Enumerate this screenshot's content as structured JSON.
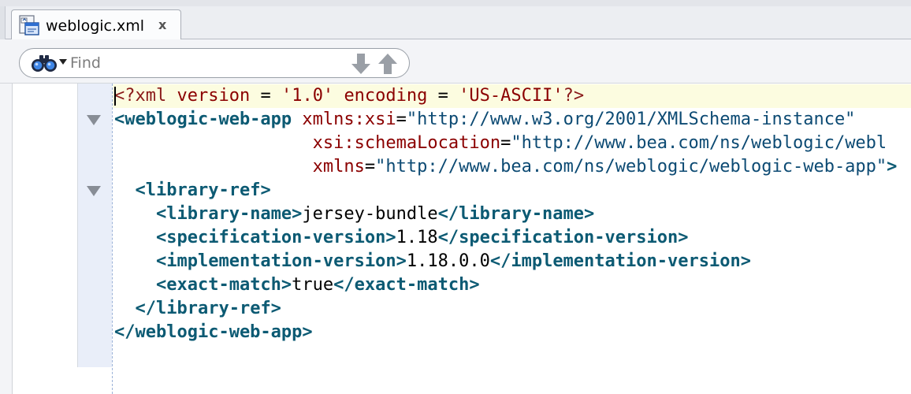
{
  "tab": {
    "label": "weblogic.xml",
    "close_label": "x",
    "icon": "xml-file-icon"
  },
  "find": {
    "placeholder": "Find",
    "value": "",
    "icons": [
      "binoculars-icon",
      "dropdown-caret-icon",
      "arrow-down-icon",
      "arrow-up-icon"
    ]
  },
  "colors": {
    "tag": "#0c5a73",
    "attr": "#8b0000",
    "value": "#0c4a73",
    "current_line": "#fcfce0",
    "gutter": "#e9eef9"
  },
  "editor": {
    "lines": [
      {
        "tokens": [
          {
            "t": "pi",
            "v": "<?xml "
          },
          {
            "t": "attr",
            "v": "version"
          },
          {
            "t": "eq",
            "v": " = "
          },
          {
            "t": "attr",
            "v": "'1.0'"
          },
          {
            "t": "text",
            "v": " "
          },
          {
            "t": "attr",
            "v": "encoding"
          },
          {
            "t": "eq",
            "v": " = "
          },
          {
            "t": "attr",
            "v": "'US-ASCII'"
          },
          {
            "t": "pi",
            "v": "?>"
          }
        ]
      },
      {
        "tokens": [
          {
            "t": "tag",
            "v": "<weblogic-web-app"
          },
          {
            "t": "text",
            "v": " "
          },
          {
            "t": "attr",
            "v": "xmlns:xsi"
          },
          {
            "t": "eq",
            "v": "="
          },
          {
            "t": "val",
            "v": "\"http://www.w3.org/2001/XMLSchema-instance\""
          }
        ]
      },
      {
        "tokens": [
          {
            "t": "text",
            "v": "                   "
          },
          {
            "t": "attr",
            "v": "xsi:schemaLocation"
          },
          {
            "t": "eq",
            "v": "="
          },
          {
            "t": "val",
            "v": "\"http://www.bea.com/ns/weblogic/webl"
          }
        ]
      },
      {
        "tokens": [
          {
            "t": "text",
            "v": "                   "
          },
          {
            "t": "attr",
            "v": "xmlns"
          },
          {
            "t": "eq",
            "v": "="
          },
          {
            "t": "val",
            "v": "\"http://www.bea.com/ns/weblogic/weblogic-web-app\""
          },
          {
            "t": "tag",
            "v": ">"
          }
        ]
      },
      {
        "tokens": [
          {
            "t": "text",
            "v": "  "
          },
          {
            "t": "tag",
            "v": "<library-ref>"
          }
        ]
      },
      {
        "tokens": [
          {
            "t": "text",
            "v": "    "
          },
          {
            "t": "tag",
            "v": "<library-name>"
          },
          {
            "t": "text",
            "v": "jersey-bundle"
          },
          {
            "t": "tag",
            "v": "</library-name>"
          }
        ]
      },
      {
        "tokens": [
          {
            "t": "text",
            "v": "    "
          },
          {
            "t": "tag",
            "v": "<specification-version>"
          },
          {
            "t": "text",
            "v": "1.18"
          },
          {
            "t": "tag",
            "v": "</specification-version>"
          }
        ]
      },
      {
        "tokens": [
          {
            "t": "text",
            "v": "    "
          },
          {
            "t": "tag",
            "v": "<implementation-version>"
          },
          {
            "t": "text",
            "v": "1.18.0.0"
          },
          {
            "t": "tag",
            "v": "</implementation-version>"
          }
        ]
      },
      {
        "tokens": [
          {
            "t": "text",
            "v": "    "
          },
          {
            "t": "tag",
            "v": "<exact-match>"
          },
          {
            "t": "text",
            "v": "true"
          },
          {
            "t": "tag",
            "v": "</exact-match>"
          }
        ]
      },
      {
        "tokens": [
          {
            "t": "text",
            "v": "  "
          },
          {
            "t": "tag",
            "v": "</library-ref>"
          }
        ]
      },
      {
        "tokens": [
          {
            "t": "tag",
            "v": "</weblogic-web-app>"
          }
        ]
      }
    ]
  }
}
